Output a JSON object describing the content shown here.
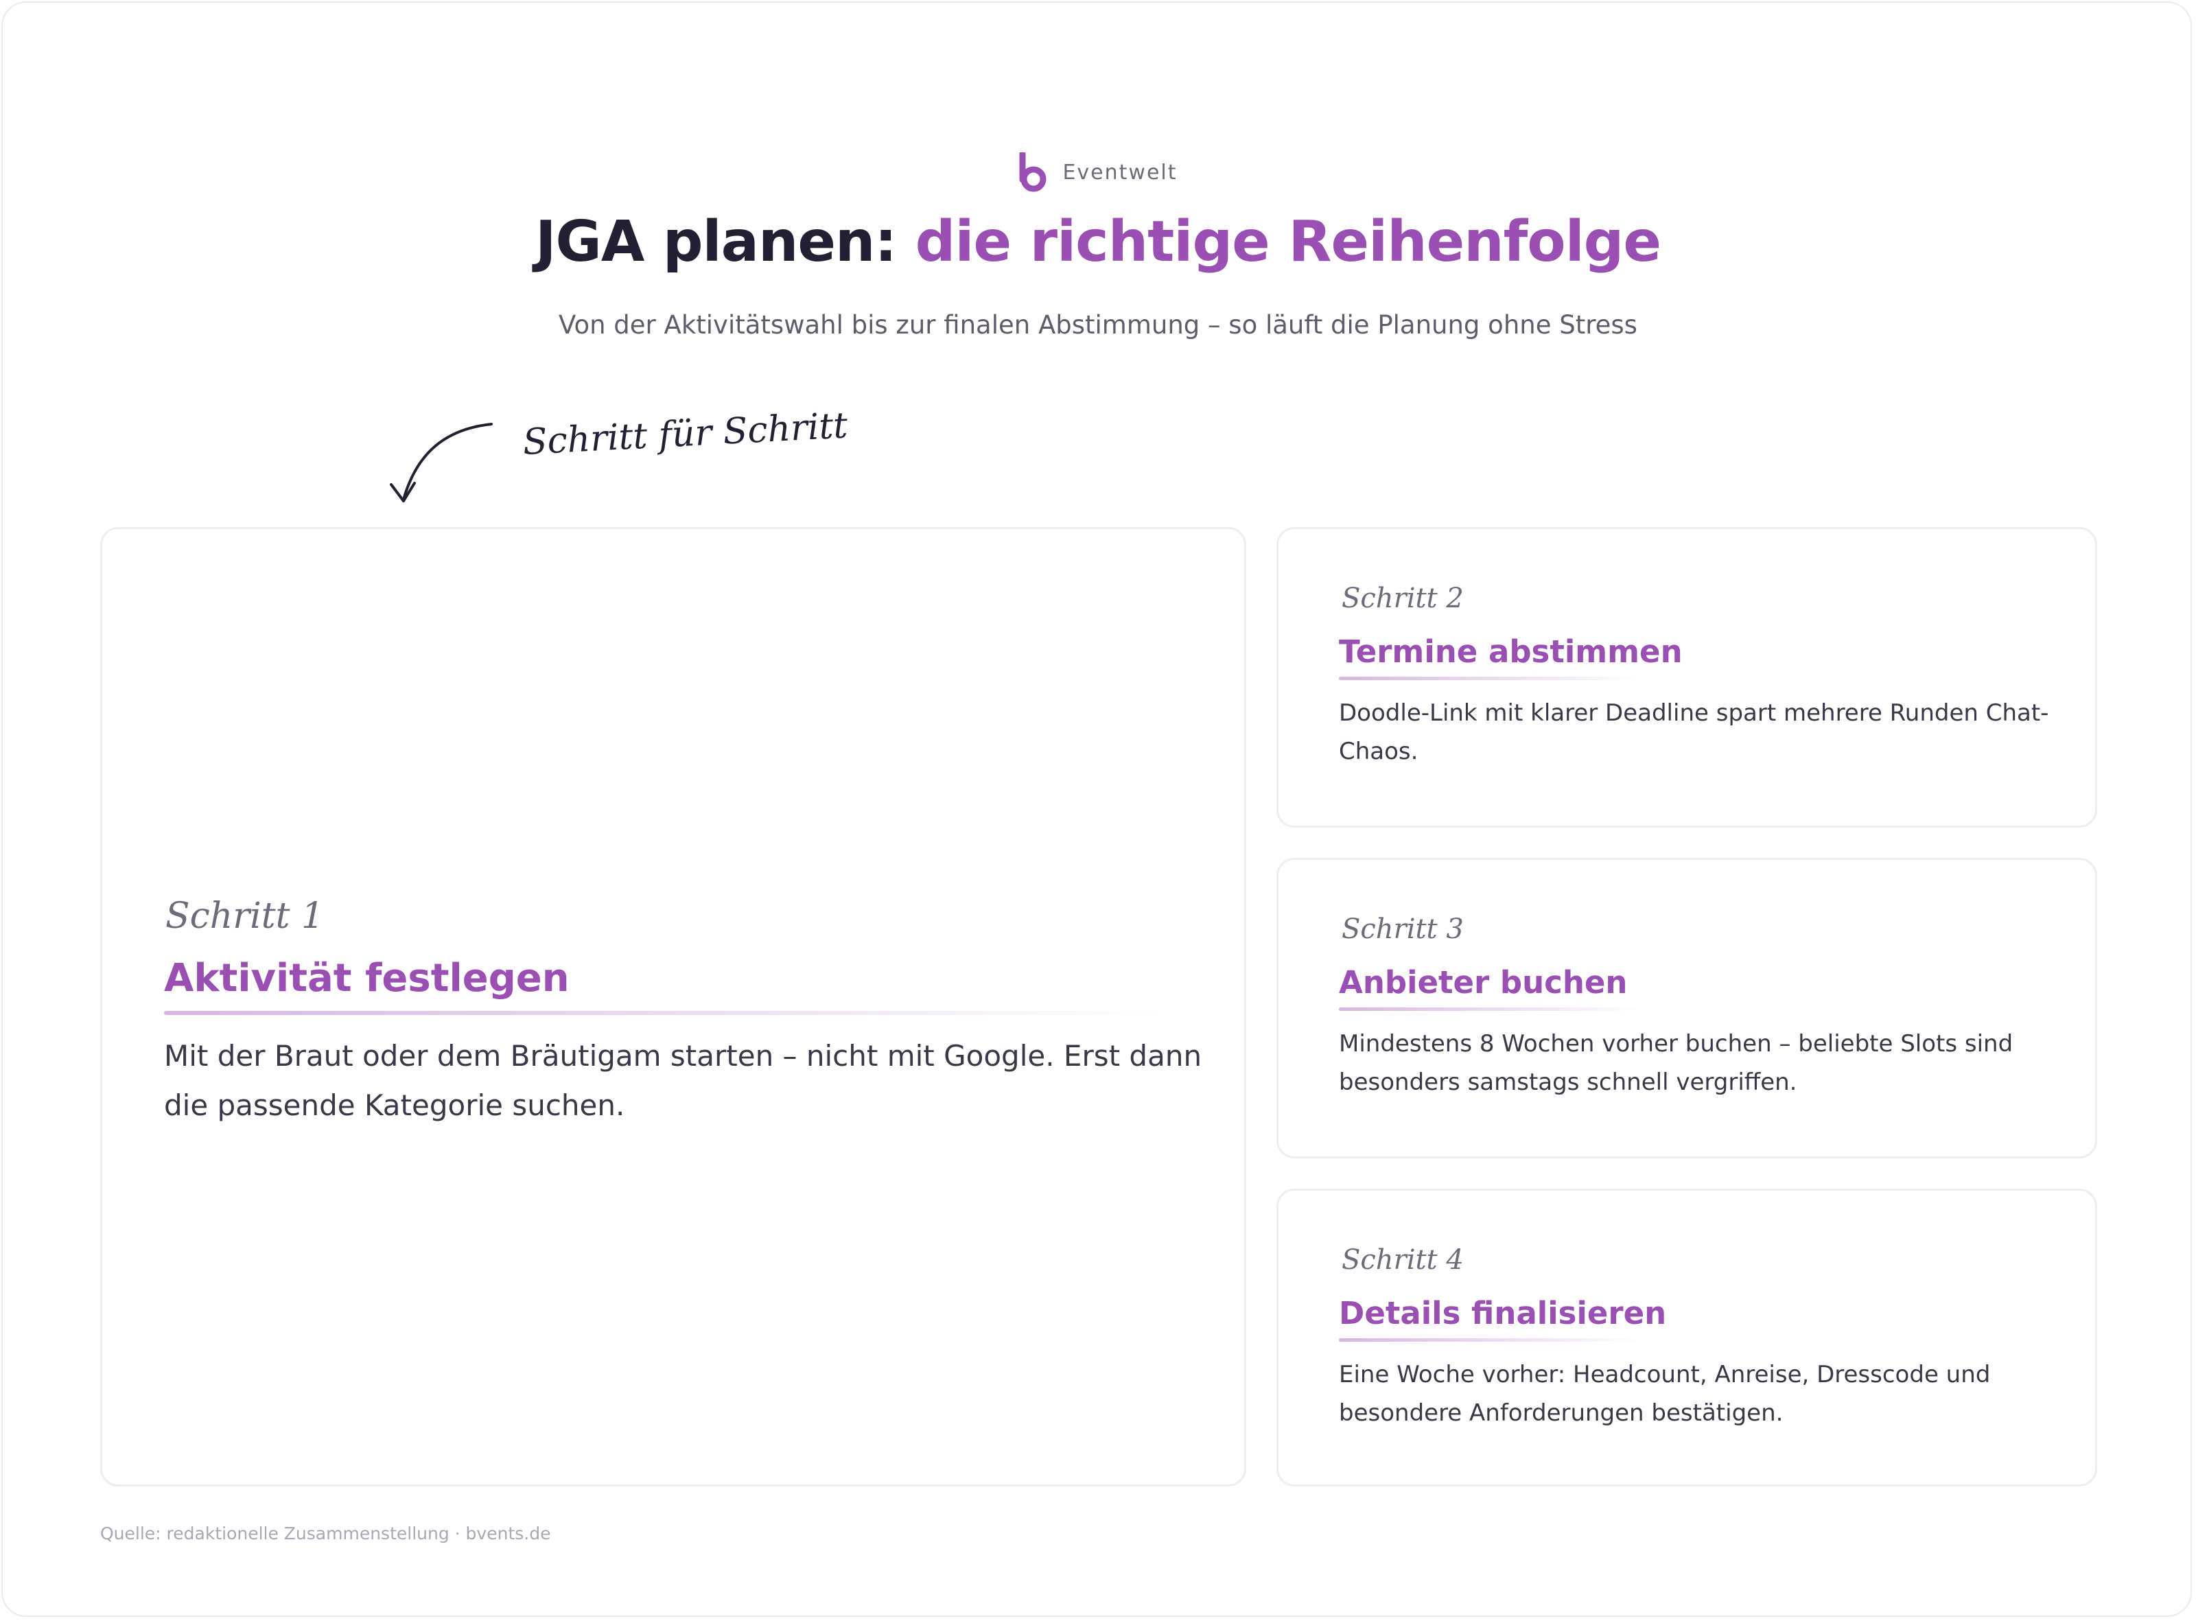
{
  "brand": {
    "name": "Eventwelt",
    "logo_icon": "b-logo-icon",
    "color": "#9a4fb2"
  },
  "header": {
    "title_main": "JGA planen: ",
    "title_accent": "die richtige Reihenfolge",
    "subtitle": "Von der Aktivitätswahl bis zur finalen Abstimmung – so läuft die Planung ohne Stress"
  },
  "note": {
    "text": "Schritt für Schritt",
    "icon": "curved-arrow-down-icon"
  },
  "steps": [
    {
      "label": "Schritt 1",
      "title": "Aktivität festlegen",
      "text": "Mit der Braut oder dem Bräutigam starten – nicht mit Google. Erst dann die passende Kategorie suchen."
    },
    {
      "label": "Schritt 2",
      "title": "Termine abstimmen",
      "text": "Doodle-Link mit klarer Deadline spart mehrere Runden Chat-Chaos."
    },
    {
      "label": "Schritt 3",
      "title": "Anbieter buchen",
      "text": "Mindestens 8 Wochen vorher buchen – beliebte Slots sind besonders samstags schnell vergriffen."
    },
    {
      "label": "Schritt 4",
      "title": "Details finalisieren",
      "text": "Eine Woche vorher: Headcount, Anreise, Dresscode und besondere Anforderungen bestätigen."
    }
  ],
  "footer": {
    "source": "Quelle: redaktionelle Zusammenstellung · bvents.de"
  },
  "colors": {
    "accent": "#9a4fb2",
    "heading": "#222032",
    "muted": "#5d5b6c"
  }
}
